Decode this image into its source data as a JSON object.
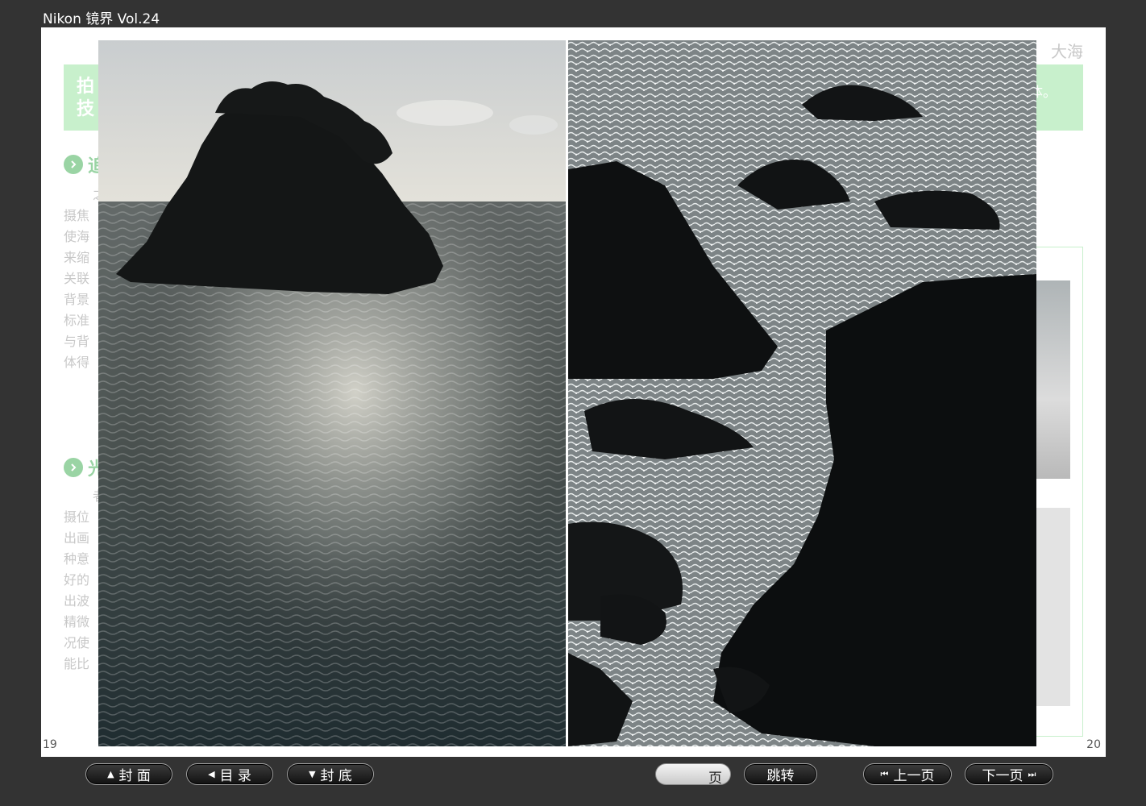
{
  "window": {
    "title": "Nikon 镜界 Vol.24"
  },
  "spread": {
    "left_page_number": "19",
    "right_page_number": "20",
    "section_label": "大海",
    "left_banner_text": "拍\n技",
    "right_banner_text": "体。",
    "headings": [
      "追",
      "光"
    ],
    "body_lines_1": [
      "之",
      "摄焦",
      "使海",
      "来缩",
      "关联",
      "背景",
      "标准",
      "与背",
      "体得"
    ],
    "body_lines_2": [
      "者",
      "摄位",
      "出画",
      "种意",
      "好的",
      "出波",
      "精微",
      "况使",
      "能比"
    ]
  },
  "photos": {
    "left": "island-silhouette-photo",
    "right": "rocky-shore-photo"
  },
  "toolbar": {
    "cover_label": "封  面",
    "toc_label": "目  录",
    "back_cover_label": "封  底",
    "page_input_value": "",
    "page_unit": "页",
    "jump_label": "跳转",
    "prev_label": "上一页",
    "next_label": "下一页"
  },
  "colors": {
    "background": "#333333",
    "banner_green": "#c8f0cc",
    "heading_green": "#9ad4a4"
  }
}
